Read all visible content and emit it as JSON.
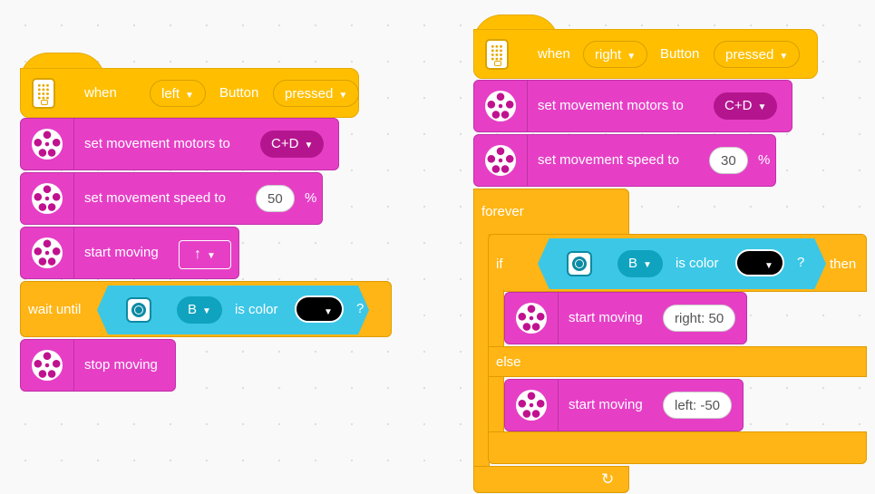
{
  "stack_left": {
    "hat": {
      "when": "when",
      "port": "left",
      "button": "Button",
      "state": "pressed"
    },
    "motors_block": {
      "label": "set movement motors to",
      "value": "C+D"
    },
    "speed_block": {
      "label": "set movement speed to",
      "value": "50",
      "unit": "%"
    },
    "start_block": {
      "label": "start moving",
      "direction": "↑"
    },
    "wait_block": {
      "label": "wait until",
      "port": "B",
      "is_color": "is color",
      "question": "?"
    },
    "stop_block": {
      "label": "stop moving"
    }
  },
  "stack_right": {
    "hat": {
      "when": "when",
      "port": "right",
      "button": "Button",
      "state": "pressed"
    },
    "motors_block": {
      "label": "set movement motors to",
      "value": "C+D"
    },
    "speed_block": {
      "label": "set movement speed to",
      "value": "30",
      "unit": "%"
    },
    "forever_label": "forever",
    "if_block": {
      "if": "if",
      "port": "B",
      "is_color": "is color",
      "question": "?",
      "then": "then"
    },
    "start_right": {
      "label": "start moving",
      "value": "right: 50"
    },
    "else_label": "else",
    "start_left": {
      "label": "start moving",
      "value": "left: -50"
    },
    "loop_icon": "↻"
  },
  "colors": {
    "events": "#ffbf00",
    "motion": "#e63fc6",
    "control": "#ffb515",
    "sensor": "#3cc7e6"
  }
}
